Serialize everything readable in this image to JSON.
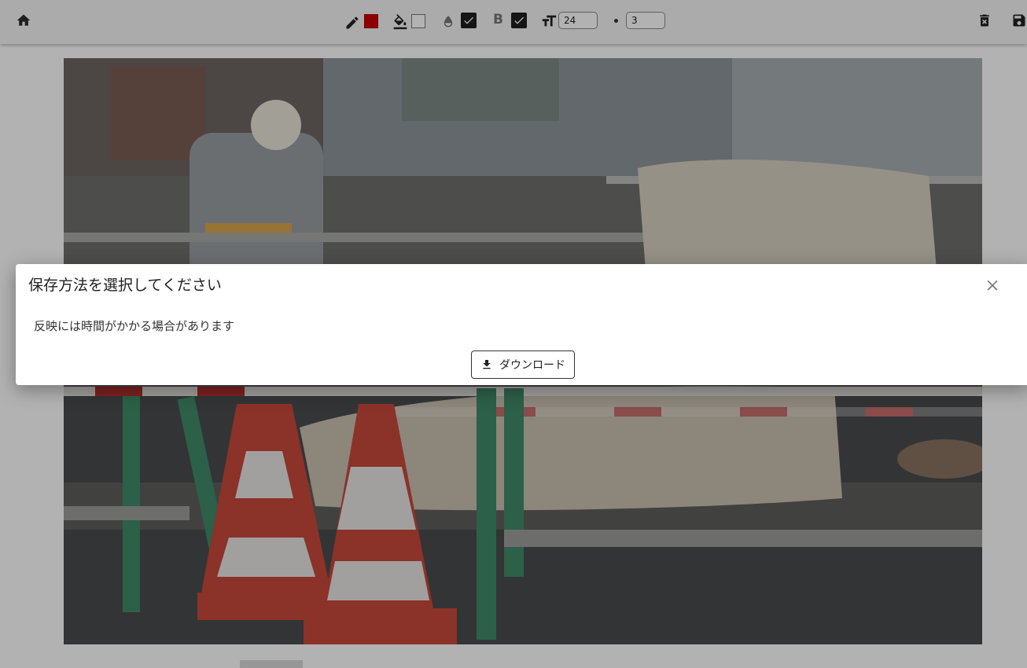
{
  "toolbar": {
    "home_icon": "home-icon",
    "pen_icon": "pen-icon",
    "pen_color": "#d00000",
    "fill_icon": "paint-bucket-icon",
    "fill_color": "#ffffff",
    "opacity_icon": "drop-icon",
    "opacity_checked": true,
    "bold_label": "B",
    "bold_checked": true,
    "font_size_icon": "text-size-icon",
    "font_size_value": "24",
    "stroke_width_value": "3",
    "delete_icon": "trash-icon",
    "save_icon": "save-icon"
  },
  "dialog": {
    "title": "保存方法を選択してください",
    "message": "反映には時間がかかる場合があります",
    "download_label": "ダウンロード",
    "close_icon": "close-icon",
    "download_icon": "download-icon"
  },
  "canvas": {
    "image_description_icon": "photo-image"
  }
}
